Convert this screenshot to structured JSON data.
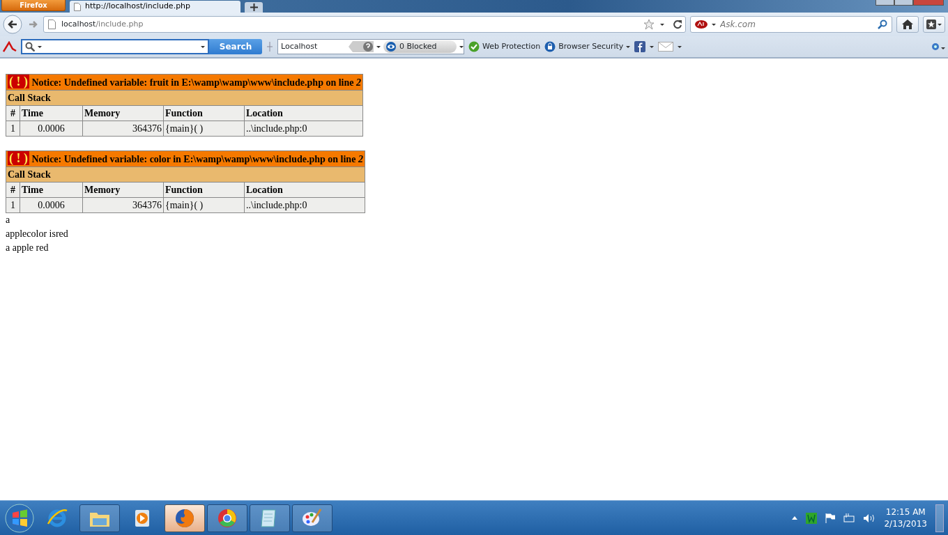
{
  "browser": {
    "menu_button": "Firefox",
    "tab": {
      "title": "http://localhost/include.php"
    },
    "address": {
      "host": "localhost",
      "path": "/include.php"
    },
    "search": {
      "placeholder": "Ask.com"
    }
  },
  "toolbar": {
    "search_button": "Search",
    "site": "Localhost",
    "blocked": "0 Blocked",
    "web_protection": "Web Protection",
    "browser_security": "Browser Security"
  },
  "notices": [
    {
      "icon": "( ! )",
      "message": "Notice: Undefined variable: fruit in E:\\wamp\\wamp\\www\\include.php on line *2*",
      "call_stack": "Call Stack",
      "columns": [
        "#",
        "Time",
        "Memory",
        "Function",
        "Location"
      ],
      "rows": [
        [
          "1",
          "0.0006",
          "364376",
          "{main}( )",
          "..\\include.php:0"
        ]
      ]
    },
    {
      "icon": "( ! )",
      "message": "Notice: Undefined variable: color in E:\\wamp\\wamp\\www\\include.php on line *2*",
      "call_stack": "Call Stack",
      "columns": [
        "#",
        "Time",
        "Memory",
        "Function",
        "Location"
      ],
      "rows": [
        [
          "1",
          "0.0006",
          "364376",
          "{main}( )",
          "..\\include.php:0"
        ]
      ]
    }
  ],
  "output": [
    "a",
    "applecolor isred",
    "a apple red"
  ],
  "taskbar": {
    "apps": [
      {
        "running": false,
        "selected": false
      },
      {
        "running": true,
        "selected": false
      },
      {
        "running": false,
        "selected": false
      },
      {
        "running": true,
        "selected": true
      },
      {
        "running": true,
        "selected": false
      },
      {
        "running": true,
        "selected": false
      },
      {
        "running": true,
        "selected": false
      }
    ],
    "time": "12:15 AM",
    "date": "2/13/2013"
  }
}
